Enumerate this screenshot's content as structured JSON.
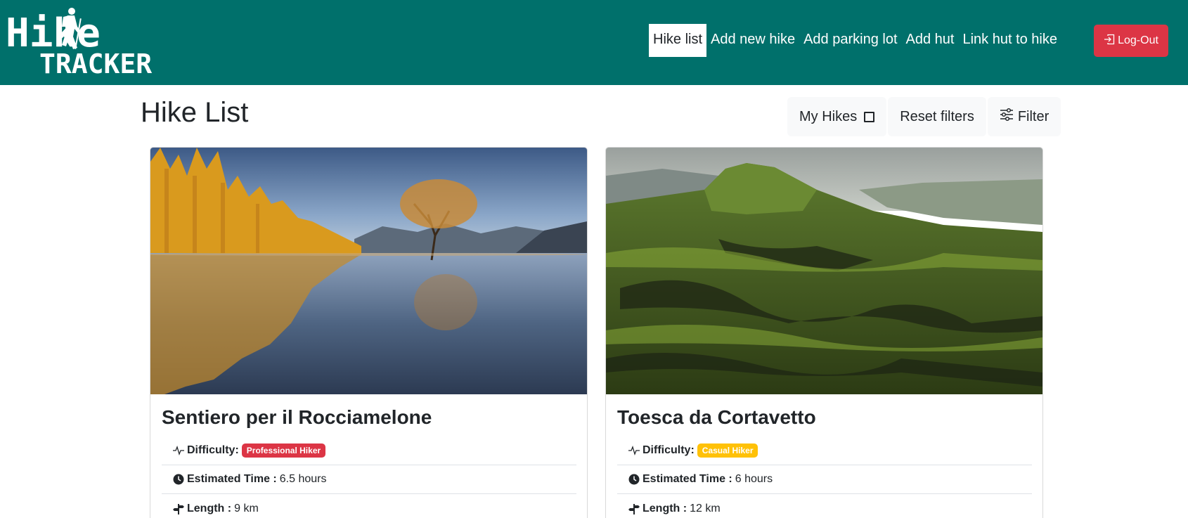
{
  "brand": {
    "logo_line1": "Hike",
    "logo_line2": "TRACKER",
    "color": "#00706b"
  },
  "nav": {
    "items": [
      {
        "label": "Hike list",
        "active": true
      },
      {
        "label": "Add new hike",
        "active": false
      },
      {
        "label": "Add parking lot",
        "active": false
      },
      {
        "label": "Add hut",
        "active": false
      },
      {
        "label": "Link hut to hike",
        "active": false
      }
    ],
    "logout_label": "Log-Out",
    "logout_icon": "box-arrow-in-right-icon"
  },
  "page": {
    "title": "Hike List"
  },
  "toolbar": {
    "my_hikes_label": "My Hikes",
    "my_hikes_checked": false,
    "reset_label": "Reset filters",
    "filter_label": "Filter",
    "filter_icon": "sliders-icon"
  },
  "hikes": [
    {
      "title": "Sentiero per il Rocciamelone",
      "image": "lake-autumn-tree",
      "difficulty_label": "Difficulty:",
      "difficulty": "Professional Hiker",
      "difficulty_color": "#dc3545",
      "time_label": "Estimated Time :",
      "time": "6.5 hours",
      "length_label": "Length :",
      "length": "9 km"
    },
    {
      "title": "Toesca da Cortavetto",
      "image": "green-volcano",
      "difficulty_label": "Difficulty:",
      "difficulty": "Casual Hiker",
      "difficulty_color": "#ffc107",
      "time_label": "Estimated Time :",
      "time": "6 hours",
      "length_label": "Length :",
      "length": "12 km"
    }
  ]
}
